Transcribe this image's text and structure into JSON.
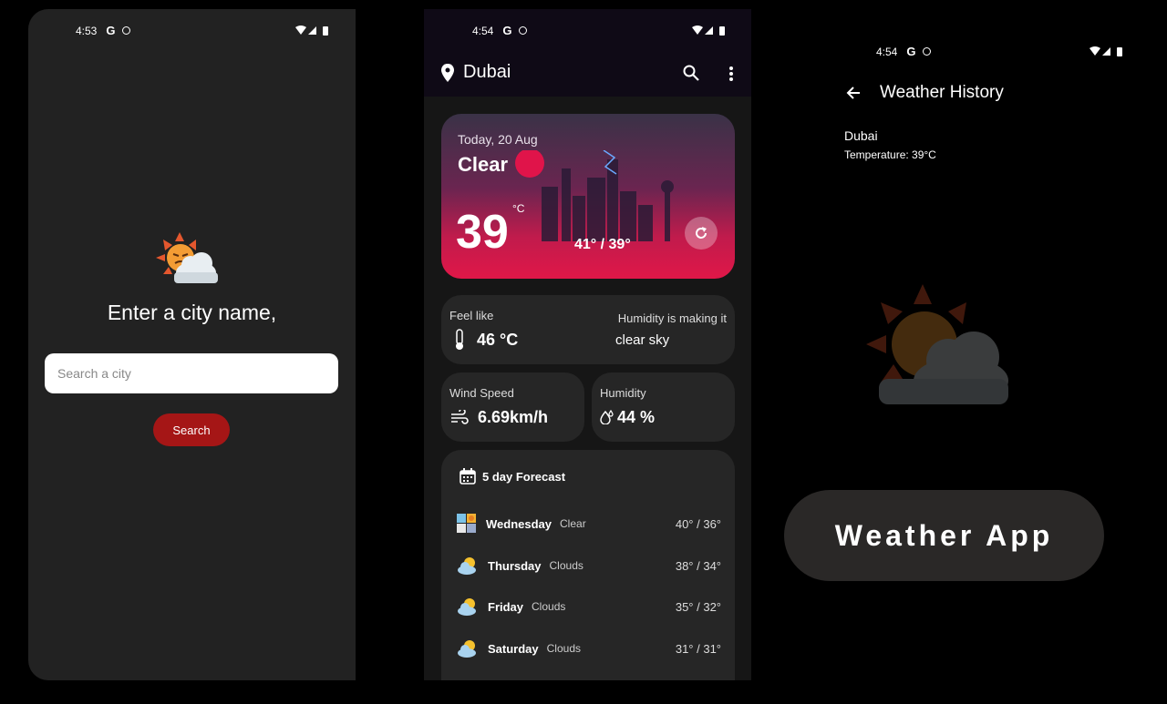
{
  "screen1": {
    "status_time": "4:53",
    "title": "Enter a city name,",
    "search_placeholder": "Search a city",
    "search_button": "Search"
  },
  "screen2": {
    "status_time": "4:54",
    "city": "Dubai",
    "date": "Today, 20 Aug",
    "condition": "Clear",
    "temp": "39",
    "unit": "°C",
    "range": "41° / 39°",
    "feel_label": "Feel like",
    "feel_value": "46 °C",
    "humid_note_label": "Humidity is making it",
    "humid_note_value": "clear sky",
    "wind_label": "Wind Speed",
    "wind_value": "6.69km/h",
    "humidity_label": "Humidity",
    "humidity_value": "44 %",
    "forecast_title": "5 day Forecast",
    "forecast": [
      {
        "day": "Wednesday",
        "desc": "Clear",
        "temps": "40° / 36°",
        "icon": "clear-icon"
      },
      {
        "day": "Thursday",
        "desc": "Clouds",
        "temps": "38° / 34°",
        "icon": "sun-cloud-icon"
      },
      {
        "day": "Friday",
        "desc": "Clouds",
        "temps": "35° / 32°",
        "icon": "sun-cloud-icon"
      },
      {
        "day": "Saturday",
        "desc": "Clouds",
        "temps": "31° / 31°",
        "icon": "sun-cloud-icon"
      }
    ]
  },
  "screen3": {
    "status_time": "4:54",
    "title": "Weather History",
    "entry_city": "Dubai",
    "entry_temp": "Temperature: 39°C",
    "banner": "Weather App"
  },
  "colors": {
    "accent_red": "#a51616",
    "card": "#262626",
    "hero_pink": "#e01748"
  }
}
